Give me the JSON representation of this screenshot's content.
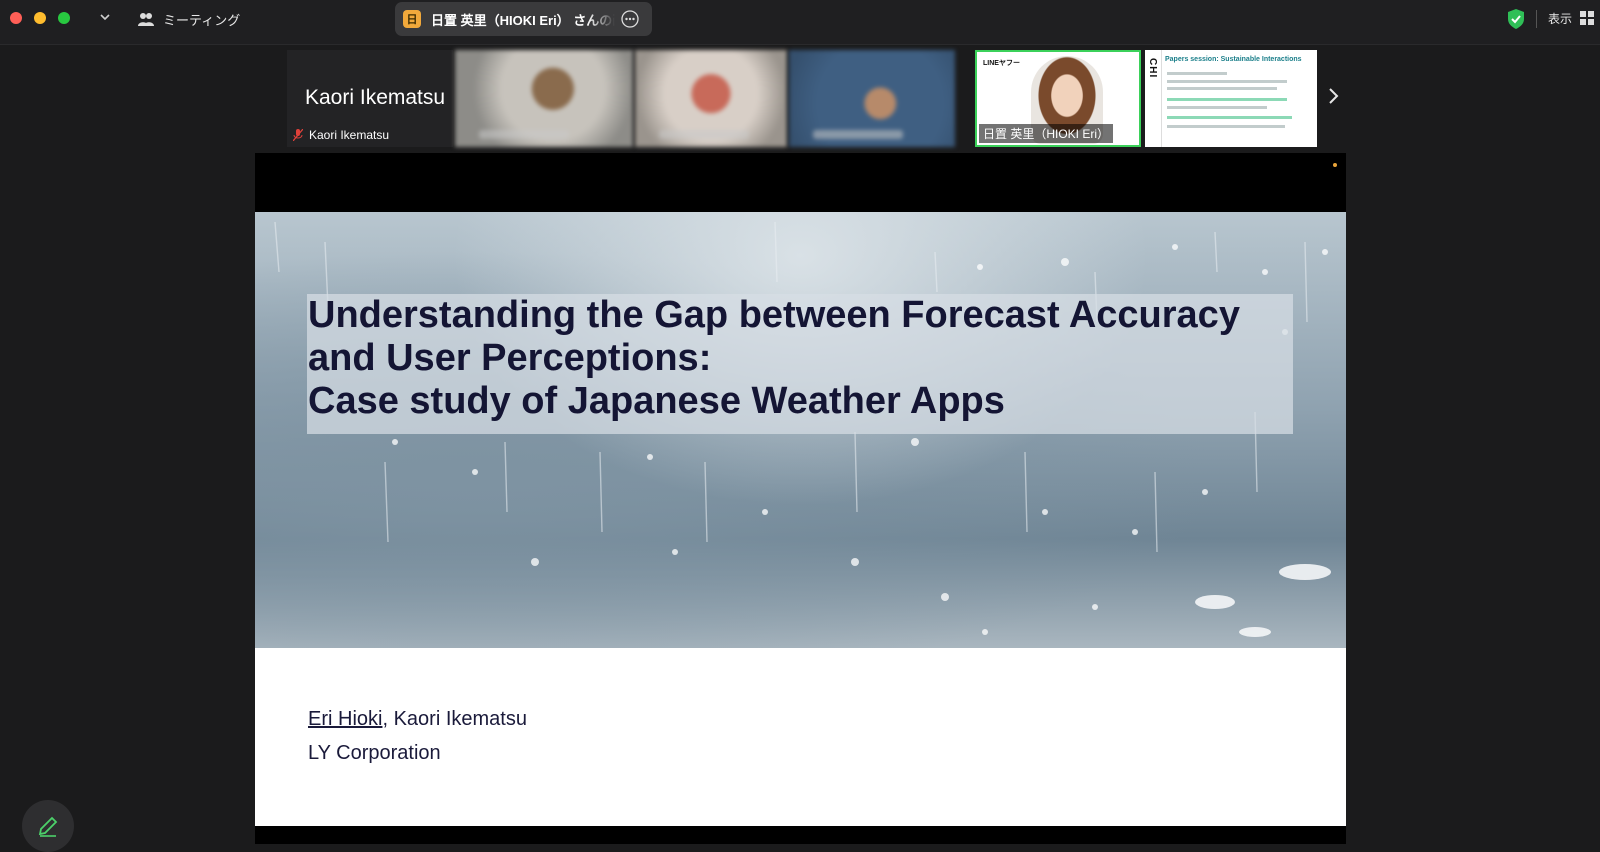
{
  "topbar": {
    "meeting_label": "ミーティング",
    "share_badge": "日",
    "share_title": "日置 英里（HIOKI Eri） さんの画面",
    "view_label": "表示"
  },
  "strip": {
    "tiles": [
      {
        "big_name": "Kaori Ikematsu",
        "name": "Kaori Ikematsu"
      },
      {
        "name": ""
      },
      {
        "name": ""
      },
      {
        "name": ""
      },
      {
        "name": "日置 英里（HIOKI Eri）",
        "logo": "LINEヤフー"
      },
      {
        "vertical_text": "CHI",
        "title": "Papers session: Sustainable Interactions"
      }
    ]
  },
  "slide": {
    "title_line1": "Understanding the Gap between Forecast Accuracy",
    "title_line2": "and User Perceptions:",
    "title_line3": "Case study of Japanese Weather Apps",
    "author_1": "Eri Hioki",
    "author_rest": ", Kaori Ikematsu",
    "organization": "LY Corporation"
  },
  "colors": {
    "accent_green": "#3bd15a",
    "title_color": "#141534"
  }
}
